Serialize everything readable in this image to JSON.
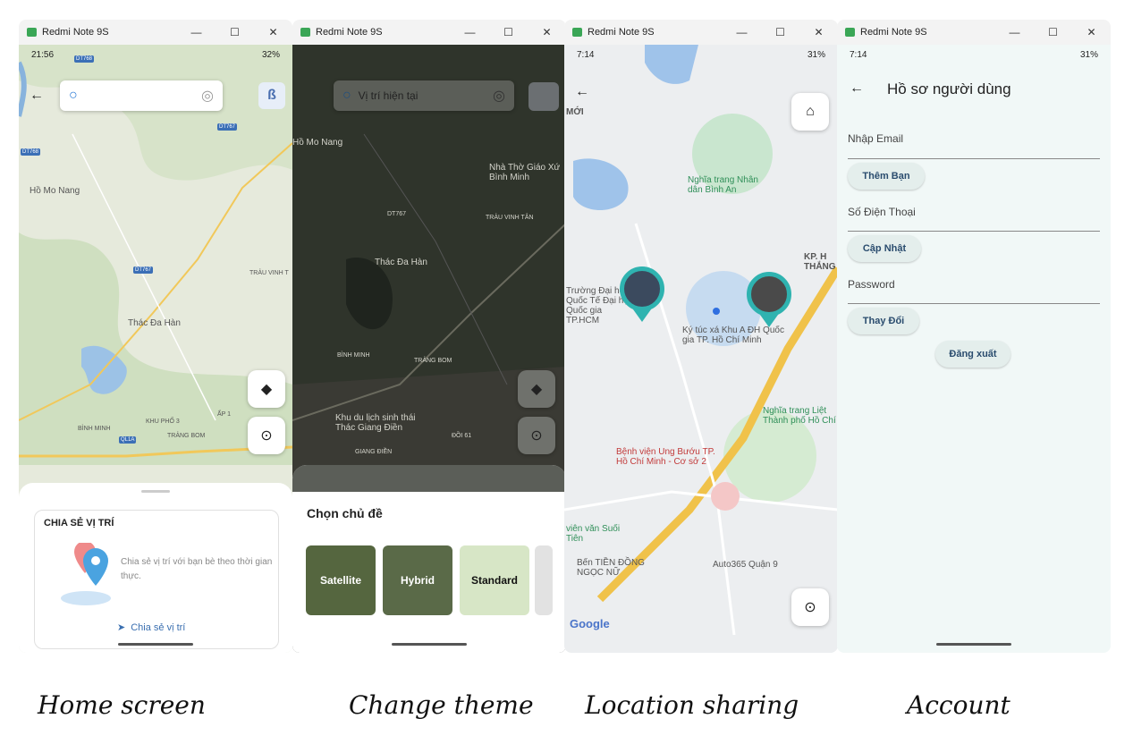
{
  "window": {
    "title": "Redmi Note 9S",
    "minimize": "—",
    "maximize": "☐",
    "close": "✕"
  },
  "captions": {
    "home": "Home screen",
    "theme": "Change theme",
    "location": "Location sharing",
    "account": "Account"
  },
  "home": {
    "status": {
      "time": "21:56",
      "battery": "32%"
    },
    "map_labels": [
      "Hồ Mo Nang",
      "Thác Đa Hàn",
      "TRẢU VINH T",
      "KHU PHỐ 3",
      "BÌNH MINH",
      "TRẢNG BOM",
      "ẤP 1"
    ],
    "road_tags": [
      "DT768",
      "DT767",
      "DT767",
      "DT768",
      "QL1A"
    ],
    "share_card": {
      "title": "CHIA SẺ VỊ TRÍ",
      "description": "Chia sẻ vị trí với bạn bè theo thời gian thực.",
      "action": "Chia sẻ vị trí"
    }
  },
  "theme": {
    "search_text": "Vị trí hiện tại",
    "map_labels": [
      "Hồ Mo Nang",
      "Nhà Thờ Giáo Xứ Bình Minh",
      "TRẢU VINH TÂN",
      "DT767",
      "Thác Đa Hàn",
      "BÌNH MINH",
      "TRẢNG BOM",
      "Khu du lịch sinh thái Thác Giang Điền",
      "ĐỒI 61",
      "GIANG ĐIỀN"
    ],
    "sheet_title": "Chọn chủ đề",
    "options": [
      "Satellite",
      "Hybrid",
      "Standard"
    ]
  },
  "location": {
    "status": {
      "time": "7:14",
      "battery": "31%"
    },
    "map_labels": [
      "MỚI",
      "Nghĩa trang Nhân dân Bình An",
      "Trường Đại học Quốc Tế Đại học Quốc gia TP.HCM",
      "Ký túc xá Khu A ĐH Quốc gia TP. Hồ Chí Minh",
      "KP. H THẮNG",
      "Nghĩa trang Liệt Thành phố Hồ Chí",
      "Bệnh viện Ung Bướu TP. Hồ Chí Minh - Cơ sở 2",
      "Bến TIỀN ĐỒNG NGỌC NỮ",
      "Auto365 Quận 9",
      "viên văn Suối Tiên"
    ],
    "google": "Google"
  },
  "account": {
    "status": {
      "time": "7:14",
      "battery": "31%"
    },
    "title": "Hồ sơ người dùng",
    "email_label": "Nhập Email",
    "add_friend": "Thêm Bạn",
    "phone_label": "Số Điện Thoại",
    "update": "Cập Nhật",
    "password_label": "Password",
    "change": "Thay Đổi",
    "logout": "Đăng xuất"
  }
}
